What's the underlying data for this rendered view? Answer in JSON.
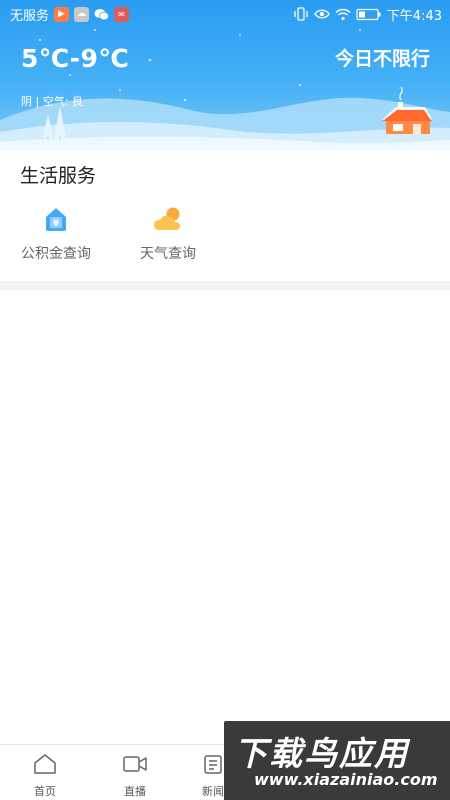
{
  "status_bar": {
    "carrier": "无服务",
    "notification_icons": [
      "video-app-icon",
      "app-icon",
      "wechat-icon",
      "app-badge-icon"
    ],
    "system_icons": [
      "vibrate-icon",
      "eye-comfort-icon",
      "wifi-icon",
      "battery-icon"
    ],
    "time": "下午4:43"
  },
  "weather": {
    "temperature": "5℃-9℃",
    "restriction": "今日不限行",
    "condition": "阴 | 空气: 良"
  },
  "services": {
    "title": "生活服务",
    "items": [
      {
        "label": "公积金查询",
        "icon": "housing-fund-icon",
        "color": "#47a8f5"
      },
      {
        "label": "天气查询",
        "icon": "weather-cloud-sun-icon",
        "color": "#f5b73b"
      }
    ]
  },
  "tabbar": {
    "items": [
      {
        "label": "首页",
        "icon": "home-icon"
      },
      {
        "label": "直播",
        "icon": "live-video-icon"
      },
      {
        "label": "新闻",
        "icon": "news-icon"
      }
    ]
  },
  "watermark": {
    "title": "下载鸟应用",
    "url": "www.xiazainiao.com"
  },
  "colors": {
    "header_top": "#2a9cf2",
    "header_bottom": "#7ccaf8",
    "house_roof": "#ff7a3d",
    "section_band": "#f1f3f6"
  }
}
